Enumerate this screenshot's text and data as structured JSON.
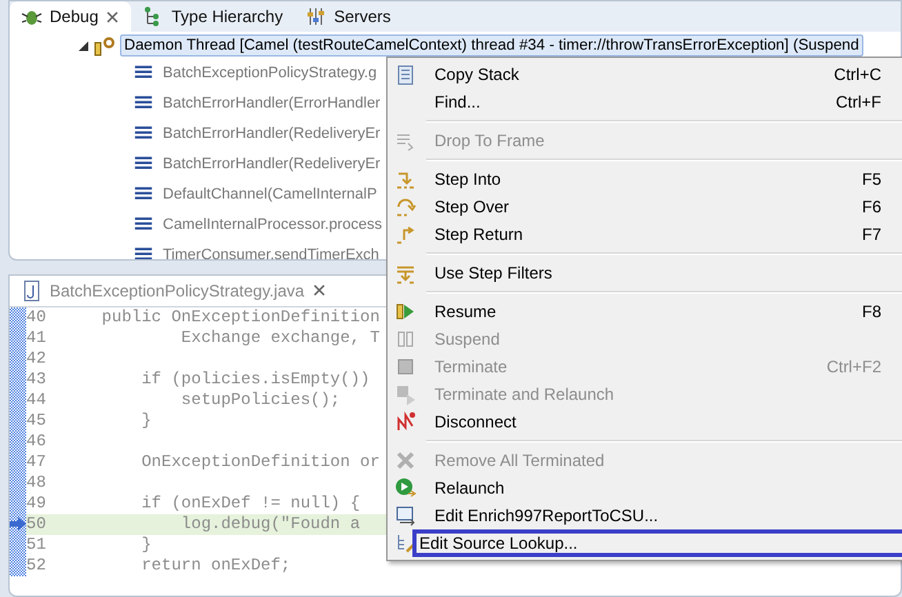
{
  "tabs": [
    {
      "label": "Debug",
      "selected": true
    },
    {
      "label": "Type Hierarchy",
      "selected": false
    },
    {
      "label": "Servers",
      "selected": false
    }
  ],
  "thread": {
    "label": "Daemon Thread [Camel (testRouteCamelContext) thread #34 - timer://throwTransErrorException] (Suspend",
    "expanded": true,
    "selected": true
  },
  "frames": [
    "BatchExceptionPolicyStrategy.g",
    "BatchErrorHandler(ErrorHandler",
    "BatchErrorHandler(RedeliveryEr",
    "BatchErrorHandler(RedeliveryEr",
    "DefaultChannel(CamelInternalP",
    "CamelInternalProcessor.process",
    "TimerConsumer.sendTimerExch"
  ],
  "editor": {
    "tab": "BatchExceptionPolicyStrategy.java",
    "lines": [
      {
        "number": "40",
        "code": "    public OnExceptionDefinition"
      },
      {
        "number": "41",
        "code": "            Exchange exchange, T"
      },
      {
        "number": "42"
      },
      {
        "number": "43",
        "code": "        if (policies.isEmpty())"
      },
      {
        "number": "44",
        "code": "            setupPolicies();"
      },
      {
        "number": "45",
        "code": "        }"
      },
      {
        "number": "46"
      },
      {
        "number": "47",
        "code": "        OnExceptionDefinition or"
      },
      {
        "number": "48"
      },
      {
        "number": "49",
        "code": "        if (onExDef != null) {"
      },
      {
        "number": "50",
        "code": "            log.debug(\"Foudn a",
        "current": true
      },
      {
        "number": "51",
        "code": "        }"
      },
      {
        "number": "52",
        "code": "        return onExDef;"
      }
    ]
  },
  "menu": [
    [
      {
        "label": "Copy Stack",
        "shortcut": "Ctrl+C",
        "disabled": false,
        "selected": false
      },
      {
        "label": "Find...",
        "shortcut": "Ctrl+F",
        "disabled": false,
        "selected": false
      }
    ],
    [
      {
        "label": "Drop To Frame",
        "disabled": true,
        "selected": false
      }
    ],
    [
      {
        "label": "Step Into",
        "shortcut": "F5",
        "disabled": false,
        "selected": false
      },
      {
        "label": "Step Over",
        "shortcut": "F6",
        "disabled": false,
        "selected": false
      },
      {
        "label": "Step Return",
        "shortcut": "F7",
        "disabled": false,
        "selected": false
      }
    ],
    [
      {
        "label": "Use Step Filters",
        "disabled": false,
        "selected": false
      }
    ],
    [
      {
        "label": "Resume",
        "shortcut": "F8",
        "disabled": false,
        "selected": false
      },
      {
        "label": "Suspend",
        "disabled": true,
        "selected": false
      },
      {
        "label": "Terminate",
        "shortcut": "Ctrl+F2",
        "disabled": true,
        "selected": false
      },
      {
        "label": "Terminate and Relaunch",
        "disabled": true,
        "selected": false
      },
      {
        "label": "Disconnect",
        "disabled": false,
        "selected": false
      }
    ],
    [
      {
        "label": "Remove All Terminated",
        "disabled": true,
        "selected": false
      },
      {
        "label": "Relaunch",
        "disabled": false,
        "selected": false
      },
      {
        "label": "Edit Enrich997ReportToCSU...",
        "disabled": false,
        "selected": false
      },
      {
        "label": "Edit Source Lookup...",
        "disabled": false,
        "selected": true
      }
    ]
  ]
}
